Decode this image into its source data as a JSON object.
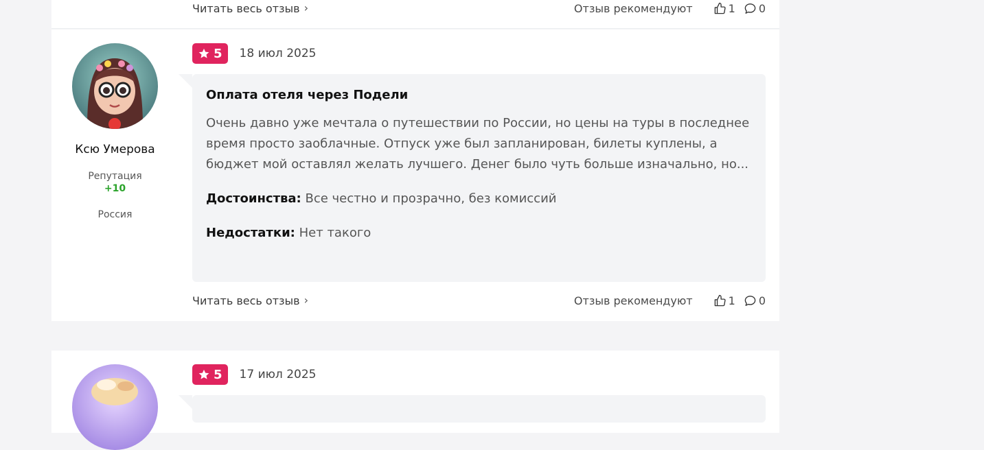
{
  "previous_review": {
    "read_more": "Читать весь отзыв",
    "recommend_label": "Отзыв рекомендуют",
    "likes": "1",
    "comments": "0"
  },
  "review": {
    "author": {
      "name": "Ксю Умерова",
      "reputation_label": "Репутация",
      "reputation_value": "+10",
      "country": "Россия"
    },
    "rating": "5",
    "date": "18 июл 2025",
    "title": "Оплата отеля через Подели",
    "text": "Очень давно уже мечтала о путешествии по России, но цены на туры в последнее время просто заоблачные. Отпуск уже был запланирован, билеты куплены, а бюджет мой оставлял желать лучшего. Денег было чуть больше изначально, но...",
    "pros_label": "Достоинства:",
    "pros": "Все честно и прозрачно, без комиссий",
    "cons_label": "Недостатки:",
    "cons": "Нет такого",
    "read_more": "Читать весь отзыв",
    "recommend_label": "Отзыв рекомендуют",
    "likes": "1",
    "comments": "0"
  },
  "next_review": {
    "rating": "5",
    "date": "17 июл 2025"
  },
  "colors": {
    "rating_badge": "#e0245e",
    "reputation_positive": "#2aa32a",
    "page_background": "#f4f4f6"
  },
  "icons": {
    "rating": "star-icon",
    "read_more": "chevron-right-icon",
    "likes": "thumbs-up-icon",
    "comments": "comment-icon"
  }
}
